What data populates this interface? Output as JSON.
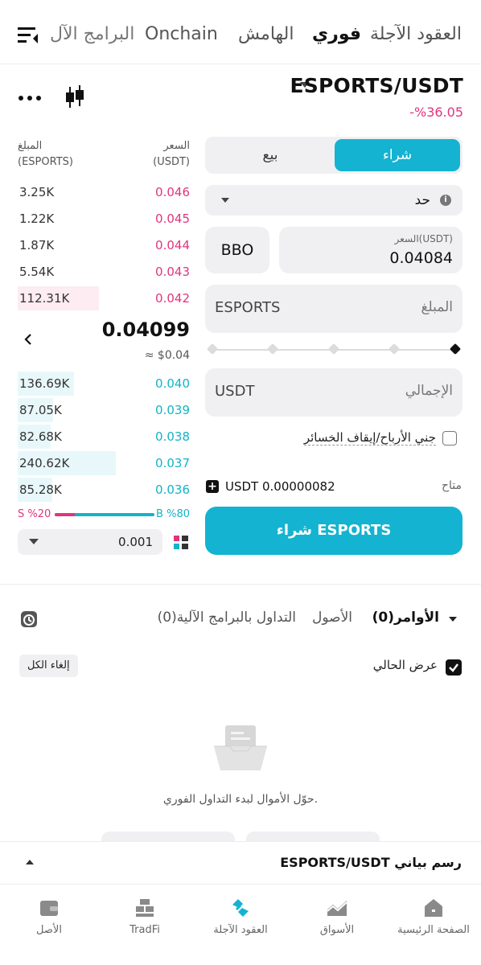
{
  "top_tabs": [
    {
      "label": "العقود الآجلة",
      "active": false
    },
    {
      "label": "فوري",
      "active": true
    },
    {
      "label": "الهامش",
      "active": false
    },
    {
      "label": "Onchain",
      "active": false
    },
    {
      "label": "البرامج الآل",
      "active": false
    }
  ],
  "pair": {
    "symbol": "ESPORTS/USDT",
    "change": "-%36.05"
  },
  "order_book": {
    "price_header": "السعر",
    "price_unit": "(USDT)",
    "amount_header": "المبلغ",
    "amount_unit": "(ESPORTS)",
    "asks": [
      {
        "price": "0.046",
        "amount": "3.25K",
        "depth": 0.0
      },
      {
        "price": "0.045",
        "amount": "1.22K",
        "depth": 0.0
      },
      {
        "price": "0.044",
        "amount": "1.87K",
        "depth": 0.0
      },
      {
        "price": "0.043",
        "amount": "5.54K",
        "depth": 0.0
      },
      {
        "price": "0.042",
        "amount": "112.31K",
        "depth": 0.47
      }
    ],
    "last_price": "0.04099",
    "last_price_fiat": "≈ $0.04",
    "bids": [
      {
        "price": "0.040",
        "amount": "136.69K",
        "depth": 0.57
      },
      {
        "price": "0.039",
        "amount": "87.05K",
        "depth": 0.36
      },
      {
        "price": "0.038",
        "amount": "82.68K",
        "depth": 0.34
      },
      {
        "price": "0.037",
        "amount": "240.62K",
        "depth": 1.0
      },
      {
        "price": "0.036",
        "amount": "85.28K",
        "depth": 0.35
      }
    ],
    "ratio_buy": "B %80",
    "ratio_sell": "S %20",
    "ratio_buy_fraction": 0.8,
    "precision": "0.001"
  },
  "form": {
    "buy_label": "شراء",
    "sell_label": "بيع",
    "order_type": "حد",
    "bbo_label": "BBO",
    "price_label": "السعر(USDT)",
    "price_value": "0.04084",
    "amount_label": "المبلغ",
    "amount_unit": "ESPORTS",
    "total_label": "الإجمالي",
    "total_unit": "USDT",
    "tpsl_label": "جني الأرباح/إيقاف الخسائر",
    "available_label": "متاح",
    "available_value": "USDT 0.00000082",
    "buy_button": "شراء ESPORTS"
  },
  "orders": {
    "tabs": [
      {
        "label": "الأوامر(0)",
        "active": true
      },
      {
        "label": "الأصول",
        "active": false
      },
      {
        "label": "التداول بالبرامج الآلية(0)",
        "active": false
      }
    ],
    "show_current": "عرض الحالي",
    "cancel_all": "إلغاء الكل",
    "empty_message": "حوّل الأموال لبدء التداول الفوري."
  },
  "chart_bar": {
    "label": "ESPORTS/USDT رسم بياني"
  },
  "bottom_nav": [
    {
      "label": "الصفحة الرئيسية",
      "icon": "home-icon"
    },
    {
      "label": "الأسواق",
      "icon": "markets-icon"
    },
    {
      "label": "العقود الآجلة",
      "icon": "futures-icon"
    },
    {
      "label": "TradFi",
      "icon": "tradfi-icon"
    },
    {
      "label": "الأصل",
      "icon": "wallet-icon"
    }
  ],
  "colors": {
    "accent": "#14b3d1",
    "sell": "#e0357d",
    "buy": "#14b3c6"
  }
}
